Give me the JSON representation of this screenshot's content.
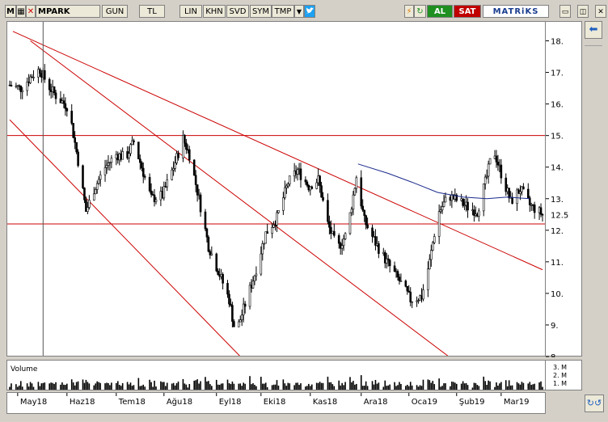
{
  "toolbar": {
    "menu_glyph": "M",
    "symbol": "MPARK",
    "currency": "GUN",
    "unit": "TL",
    "buttons": [
      "LIN",
      "KHN",
      "SVD",
      "SYM",
      "TMP"
    ],
    "dropdown_glyph": "▼",
    "share_icon": "twitter-icon",
    "lightning_glyph": "⚡",
    "refresh_glyph": "↻",
    "buy_label": "AL",
    "sell_label": "SAT",
    "brand": "MATRiKS",
    "window_minimize": "▭",
    "window_restore": "◫",
    "window_close": "✕"
  },
  "side": {
    "back_glyph": "⬅",
    "footer_glyph": "↻↺"
  },
  "volume_label": "Volume",
  "volume_ticks": [
    "3. M",
    "2. M",
    "1. M"
  ],
  "colors": {
    "candle": "#000000",
    "trend_line": "#cc0000",
    "moving_average": "#1a2a8c",
    "background": "#ffffff",
    "volume": "#000000"
  },
  "chart_data": {
    "type": "candlestick",
    "title": "",
    "ylabel": "",
    "xlabel": "",
    "ylim": [
      8,
      18.5
    ],
    "yticks": [
      8,
      9,
      10,
      11,
      12,
      13,
      14,
      15,
      16,
      17,
      18
    ],
    "ytick_labels": [
      "8.",
      "9.",
      "10.",
      "11.",
      "12.",
      "13.",
      "14.",
      "15.",
      "16.",
      "17.",
      "18."
    ],
    "last_price_label": "12.5",
    "last_price": 12.5,
    "x_ticks": [
      "May18",
      "Haz18",
      "Tem18",
      "Ağu18",
      "Eyl18",
      "Eki18",
      "Kas18",
      "Ara18",
      "Oca19",
      "Şub19",
      "Mar19"
    ],
    "x_tick_labels": [
      "May18",
      "Haz18",
      "Tem18",
      "Ağu18",
      "Eyl18",
      "Eki18",
      "Kas18",
      "Ara18",
      "Oca19",
      "Şub19",
      "Mar19"
    ],
    "period_start": "2018-04-26",
    "period_end": "2019-03-27",
    "horizontal_lines": [
      15.0,
      12.2
    ],
    "close_path": [
      [
        "2018-04-26",
        16.6
      ],
      [
        "2018-05-03",
        16.5
      ],
      [
        "2018-05-10",
        16.9
      ],
      [
        "2018-05-15",
        17.1
      ],
      [
        "2018-05-20",
        16.6
      ],
      [
        "2018-05-26",
        16.2
      ],
      [
        "2018-06-02",
        15.9
      ],
      [
        "2018-06-08",
        14.2
      ],
      [
        "2018-06-13",
        12.6
      ],
      [
        "2018-06-18",
        13.3
      ],
      [
        "2018-06-25",
        14.0
      ],
      [
        "2018-07-02",
        14.4
      ],
      [
        "2018-07-08",
        14.3
      ],
      [
        "2018-07-13",
        14.8
      ],
      [
        "2018-07-18",
        14.0
      ],
      [
        "2018-07-24",
        13.0
      ],
      [
        "2018-07-31",
        13.1
      ],
      [
        "2018-08-07",
        14.0
      ],
      [
        "2018-08-13",
        14.9
      ],
      [
        "2018-08-17",
        14.4
      ],
      [
        "2018-08-23",
        13.0
      ],
      [
        "2018-08-29",
        11.5
      ],
      [
        "2018-09-05",
        10.6
      ],
      [
        "2018-09-11",
        9.8
      ],
      [
        "2018-09-15",
        8.7
      ],
      [
        "2018-09-20",
        9.5
      ],
      [
        "2018-09-27",
        10.6
      ],
      [
        "2018-10-04",
        11.9
      ],
      [
        "2018-10-11",
        12.4
      ],
      [
        "2018-10-18",
        13.5
      ],
      [
        "2018-10-24",
        13.9
      ],
      [
        "2018-10-31",
        13.4
      ],
      [
        "2018-11-06",
        13.6
      ],
      [
        "2018-11-12",
        12.2
      ],
      [
        "2018-11-18",
        11.4
      ],
      [
        "2018-11-24",
        11.9
      ],
      [
        "2018-11-30",
        13.7
      ],
      [
        "2018-12-05",
        12.3
      ],
      [
        "2018-12-12",
        11.6
      ],
      [
        "2018-12-19",
        11.0
      ],
      [
        "2018-12-27",
        10.4
      ],
      [
        "2019-01-03",
        9.8
      ],
      [
        "2019-01-10",
        9.9
      ],
      [
        "2019-01-15",
        11.0
      ],
      [
        "2019-01-20",
        12.5
      ],
      [
        "2019-01-27",
        13.1
      ],
      [
        "2019-02-03",
        12.9
      ],
      [
        "2019-02-09",
        12.7
      ],
      [
        "2019-02-14",
        12.6
      ],
      [
        "2019-02-20",
        13.7
      ],
      [
        "2019-02-24",
        14.6
      ],
      [
        "2019-03-01",
        13.8
      ],
      [
        "2019-03-07",
        12.9
      ],
      [
        "2019-03-13",
        13.3
      ],
      [
        "2019-03-19",
        12.8
      ],
      [
        "2019-03-27",
        12.5
      ]
    ],
    "moving_average": [
      [
        "2018-12-01",
        14.1
      ],
      [
        "2018-12-20",
        13.8
      ],
      [
        "2019-01-05",
        13.5
      ],
      [
        "2019-01-20",
        13.2
      ],
      [
        "2019-02-05",
        13.05
      ],
      [
        "2019-02-20",
        13.0
      ],
      [
        "2019-03-05",
        13.05
      ],
      [
        "2019-03-19",
        13.0
      ]
    ],
    "trend_lines": [
      {
        "from": [
          "2018-04-28",
          18.3
        ],
        "to": [
          "2019-03-27",
          10.75
        ]
      },
      {
        "from": [
          "2018-05-09",
          18.0
        ],
        "to": [
          "2019-01-27",
          8.0
        ]
      },
      {
        "from": [
          "2018-04-26",
          15.5
        ],
        "to": [
          "2018-09-18",
          8.0
        ]
      }
    ],
    "cursor_date": "2018-05-17",
    "volume_range": [
      0,
      3
    ]
  }
}
